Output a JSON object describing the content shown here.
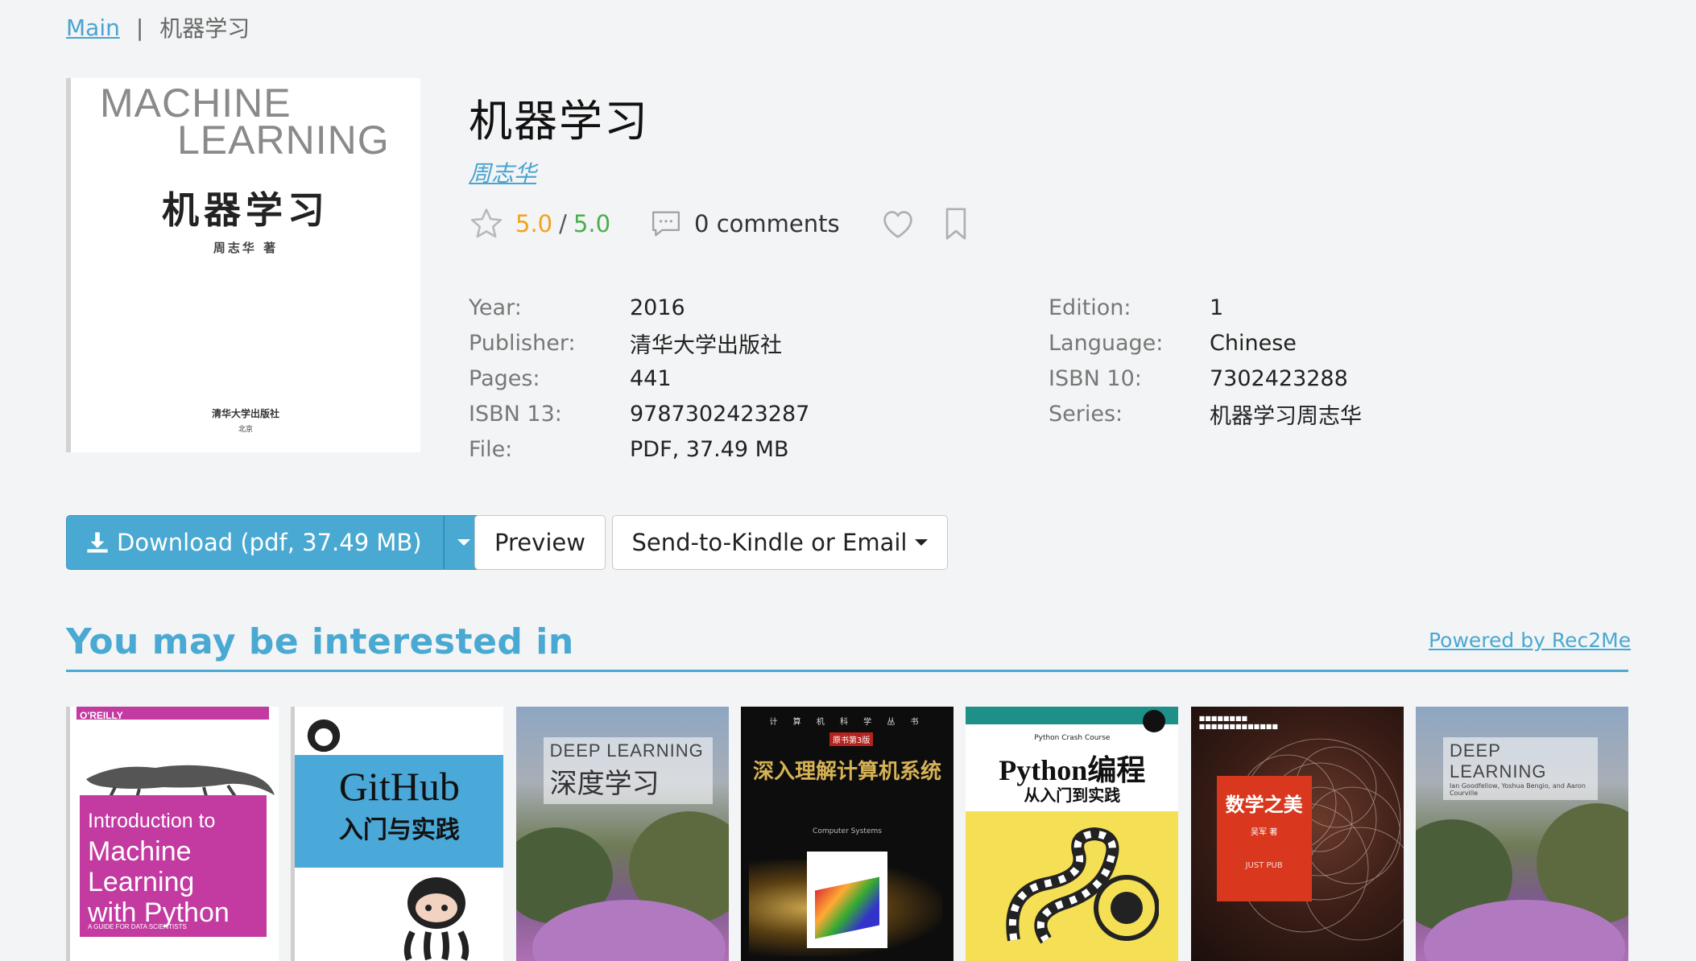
{
  "breadcrumb": {
    "home": "Main",
    "separator": "|",
    "current": "机器学习"
  },
  "cover": {
    "en_line1": "MACHINE",
    "en_line2": "LEARNING",
    "cn_title": "机器学习",
    "author": "周志华 著",
    "publisher": "清华大学出版社",
    "publisher_sub": "北京"
  },
  "book": {
    "title": "机器学习",
    "author": "周志华",
    "rating": "5.0",
    "rating_sep": "/",
    "rating_max": "5.0",
    "comments": "0 comments"
  },
  "props_left": [
    {
      "key": "Year:",
      "value": "2016"
    },
    {
      "key": "Publisher:",
      "value": "清华大学出版社"
    },
    {
      "key": "Pages:",
      "value": "441"
    },
    {
      "key": "ISBN 13:",
      "value": "9787302423287"
    },
    {
      "key": "File:",
      "value": "PDF, 37.49 MB"
    }
  ],
  "props_right": [
    {
      "key": "Edition:",
      "value": "1"
    },
    {
      "key": "Language:",
      "value": "Chinese"
    },
    {
      "key": "ISBN 10:",
      "value": "7302423288"
    },
    {
      "key": "Series:",
      "value": "机器学习周志华"
    }
  ],
  "actions": {
    "download": "Download (pdf, 37.49 MB)",
    "preview": "Preview",
    "kindle": "Send-to-Kindle or Email"
  },
  "recommendations": {
    "heading": "You may be interested in",
    "powered_by": "Powered by Rec2Me",
    "books": [
      {
        "publisher": "O'REILLY",
        "title_line1": "Introduction to",
        "title_line2": "Machine",
        "title_line3": "Learning",
        "title_line4": "with Python",
        "tag": "A GUIDE FOR DATA SCIENTISTS"
      },
      {
        "title": "GitHub",
        "subtitle": "入门与实践"
      },
      {
        "en": "DEEP LEARNING",
        "cn": "深度学习"
      },
      {
        "series": "计 算 机 科 学 丛 书",
        "badge": "原书第3版",
        "cn": "深入理解计算机系统",
        "en": "Computer Systems"
      },
      {
        "en": "Python Crash Course",
        "cn": "Python编程",
        "cn2": "从入门到实践"
      },
      {
        "cn": "数学之美",
        "author": "吴军 著",
        "mark": "JUST PUB"
      },
      {
        "en": "DEEP LEARNING",
        "authors": "Ian Goodfellow, Yoshua Bengio, and Aaron Courville"
      }
    ]
  },
  "colors": {
    "accent": "#49a9d2",
    "rating": "#f0a31c",
    "rating_max": "#4cae4c",
    "background": "#f3f4f5"
  },
  "icons": [
    "star-icon",
    "comment-icon",
    "heart-icon",
    "bookmark-icon",
    "download-icon",
    "caret-down-icon"
  ]
}
